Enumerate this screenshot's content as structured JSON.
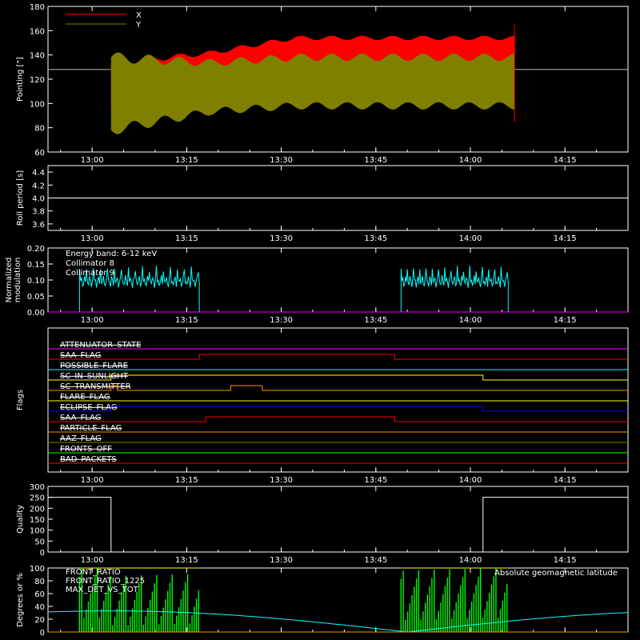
{
  "x_ticks": [
    "13:00",
    "13:15",
    "13:30",
    "13:45",
    "14:00",
    "14:15"
  ],
  "colors": {
    "x_series": "#ff0000",
    "y_series": "#808000",
    "white": "#ffffff",
    "cyan": "#00ffff",
    "magenta": "#ff00ff",
    "green": "#00ff00",
    "yellow": "#ffff00",
    "orange": "#ff8c00",
    "blue": "#0000ff",
    "red": "#ff0000"
  },
  "chart_data": [
    {
      "type": "area",
      "ylabel": "Pointing [\"]",
      "ylim": [
        60,
        180
      ],
      "yticks": [
        "60",
        "80",
        "100",
        "120",
        "140",
        "160",
        "180"
      ],
      "legend": [
        "X",
        "Y"
      ],
      "series": [
        {
          "name": "X",
          "time_range": [
            "13:03",
            "14:07"
          ],
          "center_start": 115,
          "center_end": 142,
          "amplitude": 12
        },
        {
          "name": "Y",
          "time_range": [
            "13:03",
            "14:07"
          ],
          "center_start": 108,
          "center_end": 118,
          "amplitude": 20
        }
      ],
      "reference_level": 128
    },
    {
      "type": "line",
      "ylabel": "Roll period [s]",
      "ylim": [
        3.5,
        4.5
      ],
      "yticks": [
        "3.6",
        "3.8",
        "4.0",
        "4.2",
        "4.4"
      ],
      "value": 4.0
    },
    {
      "type": "line",
      "ylabel": [
        "Normalized",
        "modulation"
      ],
      "ylim": [
        0,
        0.2
      ],
      "yticks": [
        "0.00",
        "0.05",
        "0.10",
        "0.15",
        "0.20"
      ],
      "annotation": "Energy band: 6-12 keV",
      "legend": [
        "Collimator 8",
        "Collimator 9"
      ],
      "series": [
        {
          "name": "Collimator 8",
          "segments": [
            [
              "12:58",
              "13:17"
            ],
            [
              "13:49",
              "14:06"
            ]
          ],
          "mean": 0.095
        },
        {
          "name": "Collimator 9",
          "value": 0.0
        }
      ]
    },
    {
      "type": "line",
      "ylabel": "Flags",
      "flags": [
        {
          "name": "ATTENUATOR_STATE",
          "color": "#ff00ff",
          "transitions": []
        },
        {
          "name": "SAA_FLAG_TOP",
          "label": "SAA_FLAG",
          "color": "#ff0000",
          "transitions": [
            "13:17",
            "13:48"
          ]
        },
        {
          "name": "POSSIBLE_FLARE",
          "color": "#00ffff",
          "transitions": []
        },
        {
          "name": "SC_IN_SUNLIGHT",
          "color": "#ffff00",
          "transitions": [
            "13:03",
            "14:02"
          ]
        },
        {
          "name": "SC_TRANSMITTER",
          "color": "#ff8c00",
          "transitions": [
            "13:03",
            "13:04",
            "13:22",
            "13:27"
          ]
        },
        {
          "name": "FLARE_FLAG",
          "color": "#ffff00",
          "transitions": []
        },
        {
          "name": "ECLIPSE_FLAG",
          "color": "#0000ff",
          "transitions": [
            "13:03",
            "14:02"
          ]
        },
        {
          "name": "SAA_FLAG",
          "color": "#ff0000",
          "transitions": [
            "13:18",
            "13:48"
          ]
        },
        {
          "name": "PARTICLE_FLAG",
          "color": "#ff8c00",
          "transitions": []
        },
        {
          "name": "AAZ_FLAG",
          "color": "#808000",
          "transitions": []
        },
        {
          "name": "FRONTS_OFF",
          "color": "#00ff00",
          "transitions": []
        },
        {
          "name": "BAD_PACKETS",
          "color": "#ff0000",
          "transitions": []
        }
      ]
    },
    {
      "type": "line",
      "ylabel": "Quality",
      "ylim": [
        0,
        300
      ],
      "yticks": [
        "0",
        "50",
        "100",
        "150",
        "200",
        "250",
        "300"
      ],
      "segments": [
        {
          "from": "12:53",
          "to": "13:03",
          "value": 250
        },
        {
          "from": "13:03",
          "to": "14:02",
          "value": 0
        },
        {
          "from": "14:02",
          "to": "14:25",
          "value": 250
        }
      ]
    },
    {
      "type": "line",
      "ylabel": "Degrees or %",
      "ylim": [
        0,
        100
      ],
      "yticks": [
        "0",
        "20",
        "40",
        "60",
        "80",
        "100"
      ],
      "legend": [
        "FRONT_RATIO",
        "FRONT_RATIO_1225",
        "MAX_DET_VS_TOT"
      ],
      "annotation": "Absolute geomagnetic latitude",
      "green_bursts": [
        [
          "12:58",
          "13:17"
        ],
        [
          "13:49",
          "14:06"
        ]
      ]
    }
  ]
}
